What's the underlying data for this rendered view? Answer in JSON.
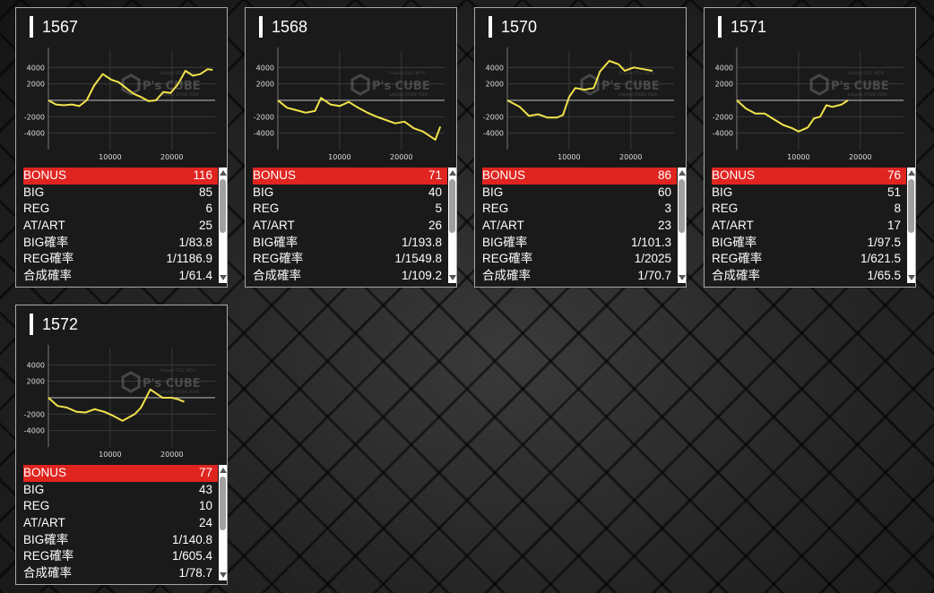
{
  "logo": {
    "main": "P's CUBE",
    "sub_top": "Purpose STILL WITH",
    "sub_bottom": "adopted STORE YOUR"
  },
  "colors": {
    "line": "#f2e34a",
    "bonus_row": "#e02420",
    "axis": "#bdbdbd"
  },
  "stat_labels": [
    "BONUS",
    "BIG",
    "REG",
    "AT/ART",
    "BIG確率",
    "REG確率",
    "合成確率"
  ],
  "cards": [
    {
      "id": "1567",
      "stats": [
        "116",
        "85",
        "6",
        "25",
        "1/83.8",
        "1/1186.9",
        "1/61.4"
      ],
      "chart_data": {
        "type": "line",
        "y_ticks": [
          "4000",
          "2000",
          "-2000",
          "-4000"
        ],
        "x_ticks": [
          "10000",
          "20000"
        ],
        "xlim": [
          0,
          27000
        ],
        "ylim": [
          -6000,
          6000
        ],
        "x": [
          0,
          1200,
          2500,
          3800,
          5000,
          6200,
          7400,
          8800,
          10200,
          11400,
          12600,
          13800,
          15000,
          16200,
          17400,
          18600,
          19800,
          21000,
          22200,
          23400,
          24600,
          25800,
          26600
        ],
        "y": [
          0,
          -500,
          -600,
          -500,
          -700,
          0,
          1800,
          3200,
          2500,
          2200,
          1500,
          800,
          400,
          -100,
          0,
          1000,
          900,
          2000,
          3600,
          3000,
          3200,
          3800,
          3700
        ]
      }
    },
    {
      "id": "1568",
      "stats": [
        "71",
        "40",
        "5",
        "26",
        "1/193.8",
        "1/1549.8",
        "1/109.2"
      ],
      "chart_data": {
        "type": "line",
        "y_ticks": [
          "4000",
          "2000",
          "-2000",
          "-4000"
        ],
        "x_ticks": [
          "10000",
          "20000"
        ],
        "xlim": [
          0,
          27000
        ],
        "ylim": [
          -6000,
          6000
        ],
        "x": [
          0,
          1500,
          3000,
          4500,
          6000,
          7000,
          8500,
          10000,
          11500,
          13000,
          14500,
          16000,
          17500,
          19000,
          20500,
          22000,
          23500,
          24500,
          25500,
          26300
        ],
        "y": [
          0,
          -900,
          -1200,
          -1500,
          -1300,
          300,
          -500,
          -700,
          -200,
          -900,
          -1500,
          -2000,
          -2400,
          -2800,
          -2600,
          -3400,
          -3800,
          -4300,
          -4800,
          -3200
        ]
      }
    },
    {
      "id": "1570",
      "stats": [
        "86",
        "60",
        "3",
        "23",
        "1/101.3",
        "1/2025",
        "1/70.7"
      ],
      "chart_data": {
        "type": "line",
        "y_ticks": [
          "4000",
          "2000",
          "-2000",
          "-4000"
        ],
        "x_ticks": [
          "10000",
          "20000"
        ],
        "xlim": [
          0,
          27000
        ],
        "ylim": [
          -6000,
          6000
        ],
        "x": [
          0,
          2000,
          3500,
          5000,
          6500,
          8000,
          9000,
          10000,
          11000,
          12500,
          14000,
          15000,
          16500,
          18000,
          19000,
          20500,
          22000,
          23500
        ],
        "y": [
          0,
          -800,
          -1900,
          -1700,
          -2100,
          -2100,
          -1800,
          400,
          1500,
          1300,
          1500,
          3500,
          4800,
          4400,
          3600,
          4000,
          3800,
          3600
        ]
      }
    },
    {
      "id": "1571",
      "stats": [
        "76",
        "51",
        "8",
        "17",
        "1/97.5",
        "1/621.5",
        "1/65.5"
      ],
      "chart_data": {
        "type": "line",
        "y_ticks": [
          "4000",
          "2000",
          "-2000",
          "-4000"
        ],
        "x_ticks": [
          "10000",
          "20000"
        ],
        "xlim": [
          0,
          27000
        ],
        "ylim": [
          -6000,
          6000
        ],
        "x": [
          0,
          1500,
          3000,
          4500,
          6000,
          7500,
          9000,
          10000,
          11500,
          12500,
          13500,
          14500,
          15500,
          17000,
          18000
        ],
        "y": [
          0,
          -1000,
          -1600,
          -1600,
          -2300,
          -3000,
          -3400,
          -3800,
          -3300,
          -2200,
          -2000,
          -600,
          -800,
          -500,
          0
        ]
      }
    },
    {
      "id": "1572",
      "stats": [
        "77",
        "43",
        "10",
        "24",
        "1/140.8",
        "1/605.4",
        "1/78.7"
      ],
      "chart_data": {
        "type": "line",
        "y_ticks": [
          "4000",
          "2000",
          "-2000",
          "-4000"
        ],
        "x_ticks": [
          "10000",
          "20000"
        ],
        "xlim": [
          0,
          27000
        ],
        "ylim": [
          -6000,
          6000
        ],
        "x": [
          0,
          1500,
          3000,
          4500,
          6000,
          7500,
          9000,
          10500,
          12000,
          13000,
          14000,
          15000,
          16500,
          17500,
          18500,
          20000,
          21000,
          22000
        ],
        "y": [
          0,
          -1000,
          -1200,
          -1700,
          -1800,
          -1400,
          -1700,
          -2200,
          -2800,
          -2400,
          -2000,
          -1200,
          1000,
          500,
          0,
          0,
          -200,
          -500
        ]
      }
    }
  ]
}
